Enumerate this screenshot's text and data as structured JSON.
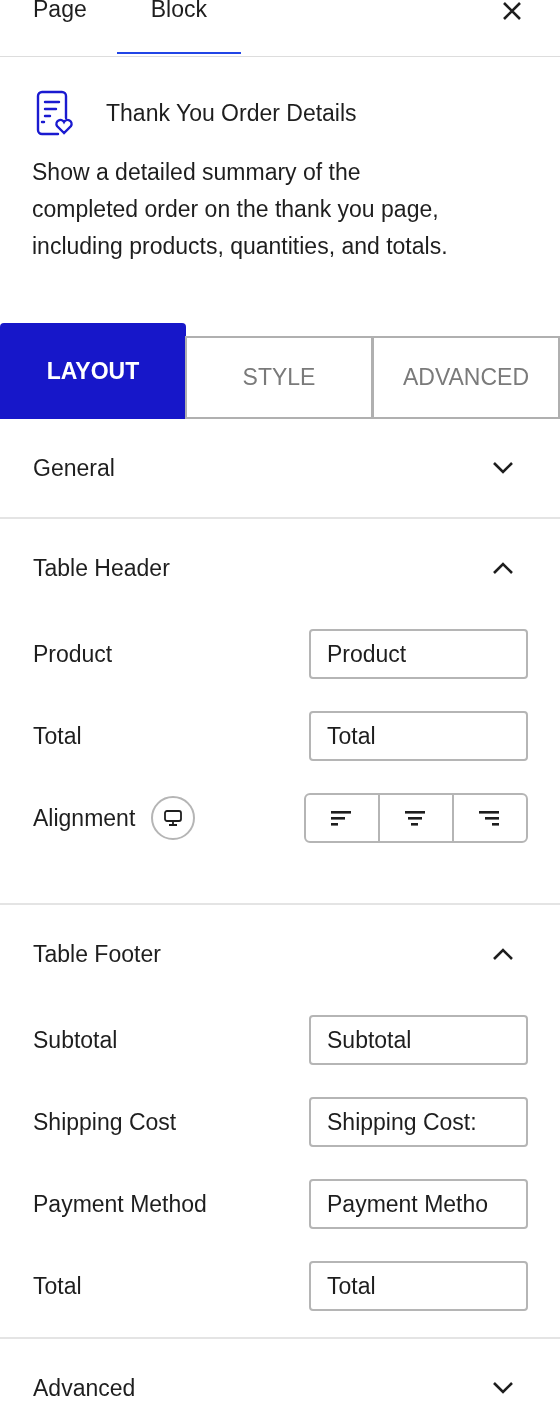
{
  "top_tabs": [
    {
      "label": "Page",
      "selected": false
    },
    {
      "label": "Block",
      "selected": true
    }
  ],
  "block": {
    "title": "Thank You Order Details",
    "description": "Show a detailed summary of the completed order on the thank you page, including products, quantities, and totals."
  },
  "panel_tabs": [
    {
      "label": "LAYOUT",
      "selected": true
    },
    {
      "label": "STYLE",
      "selected": false
    },
    {
      "label": "ADVANCED",
      "selected": false
    }
  ],
  "sections": [
    {
      "title": "General",
      "expanded": false
    },
    {
      "title": "Table Header",
      "expanded": true,
      "fields": [
        {
          "kind": "text",
          "label": "Product",
          "value": "Product"
        },
        {
          "kind": "text",
          "label": "Total",
          "value": "Total"
        },
        {
          "kind": "alignment",
          "label": "Alignment",
          "options": [
            {
              "kind": "left"
            },
            {
              "kind": "center"
            },
            {
              "kind": "right"
            }
          ]
        }
      ]
    },
    {
      "title": "Table Footer",
      "expanded": true,
      "fields": [
        {
          "kind": "text",
          "label": "Subtotal",
          "value": "Subtotal"
        },
        {
          "kind": "text",
          "label": "Shipping Cost",
          "value": "Shipping Cost:"
        },
        {
          "kind": "text",
          "label": "Payment Method",
          "value": "Payment Metho"
        },
        {
          "kind": "text",
          "label": "Total",
          "value": "Total"
        }
      ]
    },
    {
      "title": "Advanced",
      "expanded": false
    }
  ]
}
